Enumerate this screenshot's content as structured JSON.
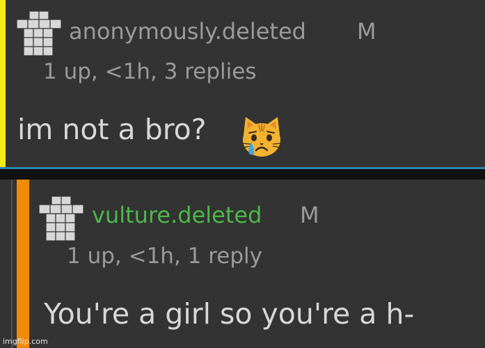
{
  "colors": {
    "background": "#333333",
    "depth_bar_1": "#f4eb1a",
    "depth_bar_2": "#f08b0a",
    "divider": "#2a86b4",
    "username_1": "#9b9b9b",
    "username_2": "#4cb84a",
    "meta_text": "#9b9b9b",
    "body_text": "#d8d8d8"
  },
  "comments": [
    {
      "avatar_icon": "default-avatar-icon",
      "username": "anonymously.deleted",
      "badge": "M",
      "meta": "1 up, <1h, 3 replies",
      "text": "im not a bro?",
      "emoji_icon": "crying-cat-face-icon"
    },
    {
      "avatar_icon": "default-avatar-icon",
      "username": "vulture.deleted",
      "badge": "M",
      "meta": "1 up, <1h, 1 reply",
      "text": "You're a girl so you're a h-"
    }
  ],
  "watermark": "imgflip.com"
}
